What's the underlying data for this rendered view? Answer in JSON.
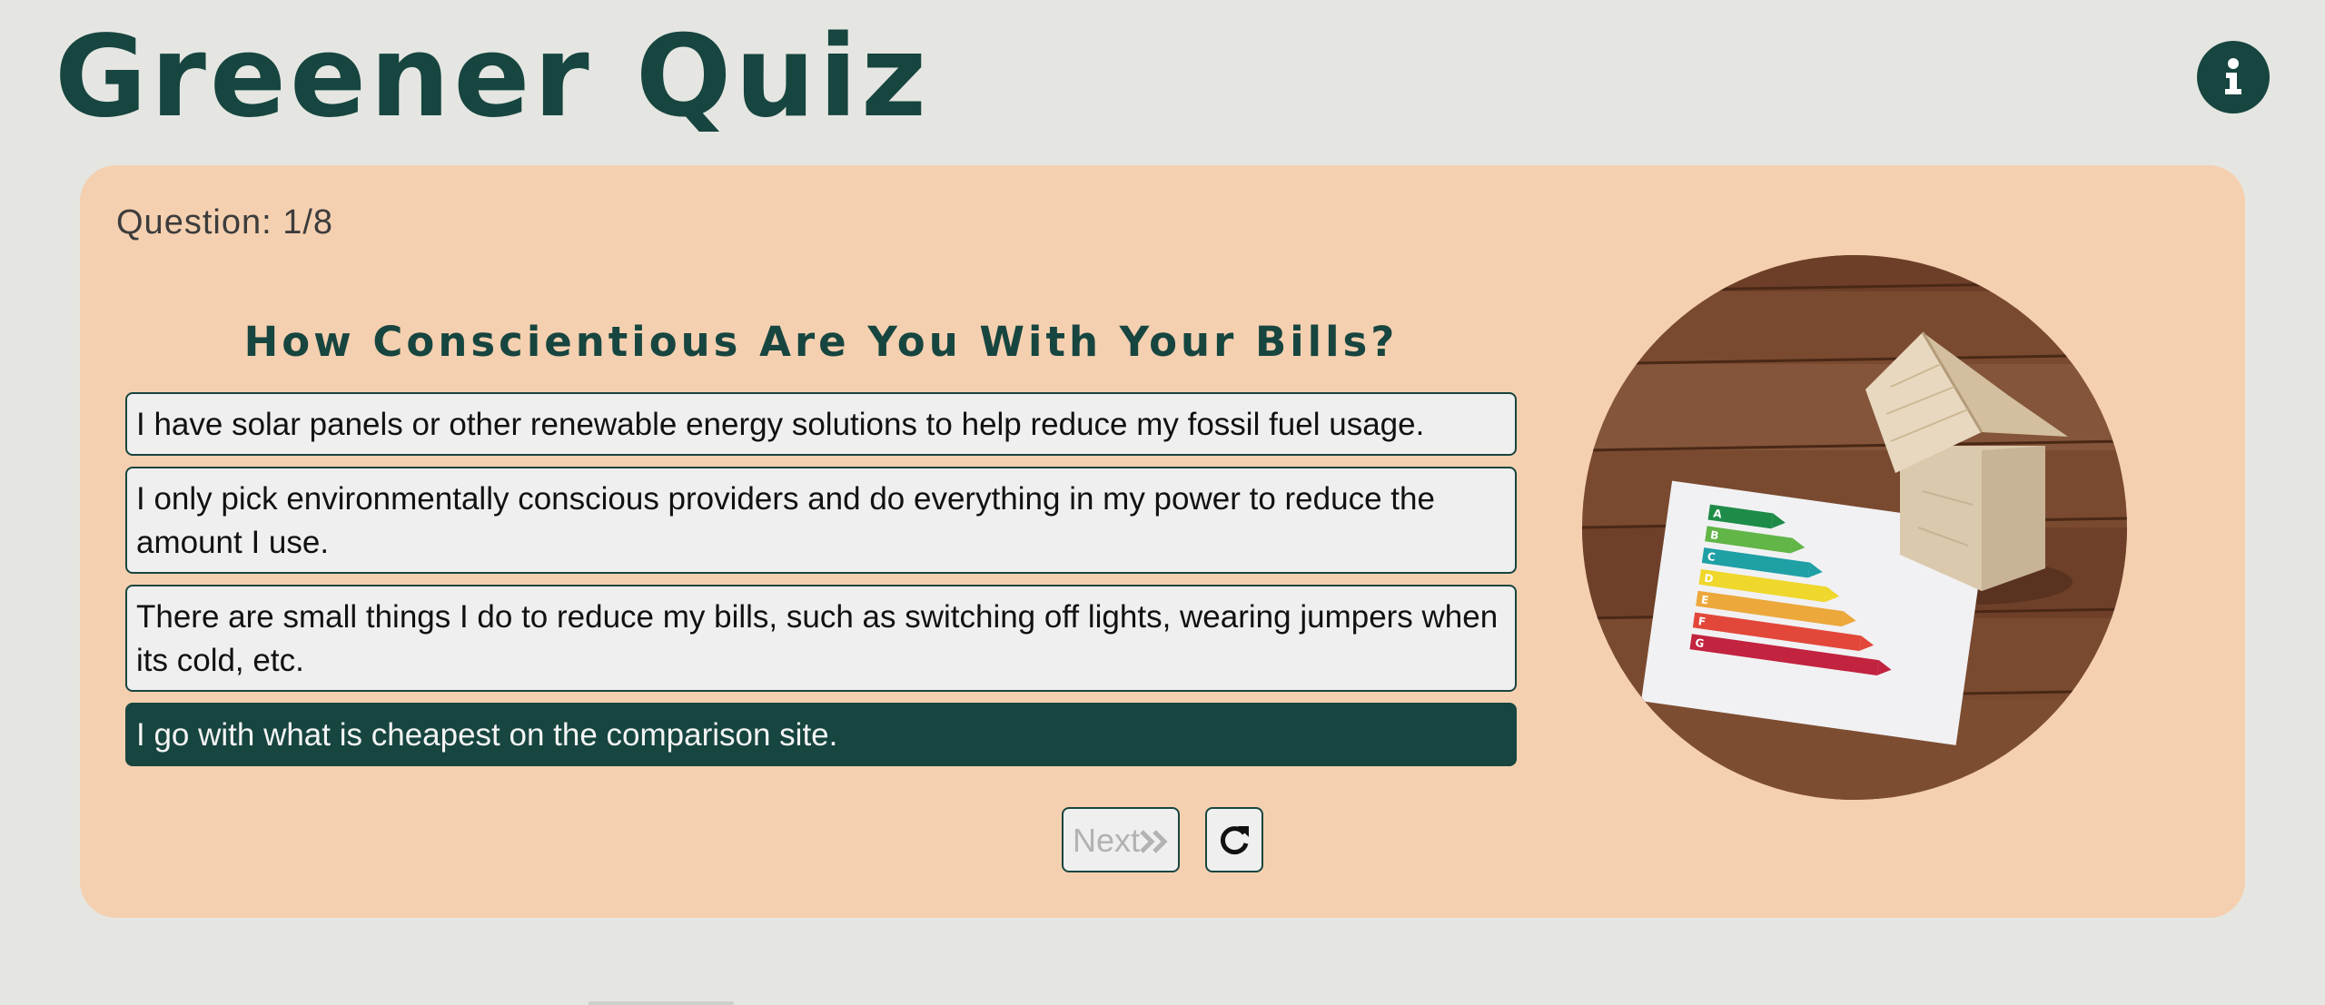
{
  "header": {
    "title": "Greener Quiz",
    "info_icon": "info-circle-icon"
  },
  "quiz": {
    "counter": "Question: 1/8",
    "question": "How Conscientious Are You With Your Bills?",
    "answers": [
      "I have solar panels or other renewable energy solutions to help reduce my fossil fuel usage.",
      "I only pick environmentally conscious providers and do everything in my power to reduce the amount I use.",
      "There are small things I do to reduce my bills, such as switching off lights, wearing jumpers when its cold, etc.",
      "I go with what is cheapest on the comparison site."
    ],
    "selected_answer_index": 3,
    "image": {
      "subject": "wooden house model with energy efficiency rating label",
      "rating_labels": [
        "A",
        "B",
        "C",
        "D",
        "E",
        "F",
        "G"
      ]
    }
  },
  "controls": {
    "next_label": "Next",
    "next_icon": "double-chevron-right-icon",
    "next_enabled": false,
    "reset_icon": "redo-icon"
  },
  "colors": {
    "background": "#e5e6e2",
    "brand": "#17453f",
    "card": "#f4d0b0",
    "answer_background": "#efefef",
    "disabled_text": "#b2b2b2"
  }
}
